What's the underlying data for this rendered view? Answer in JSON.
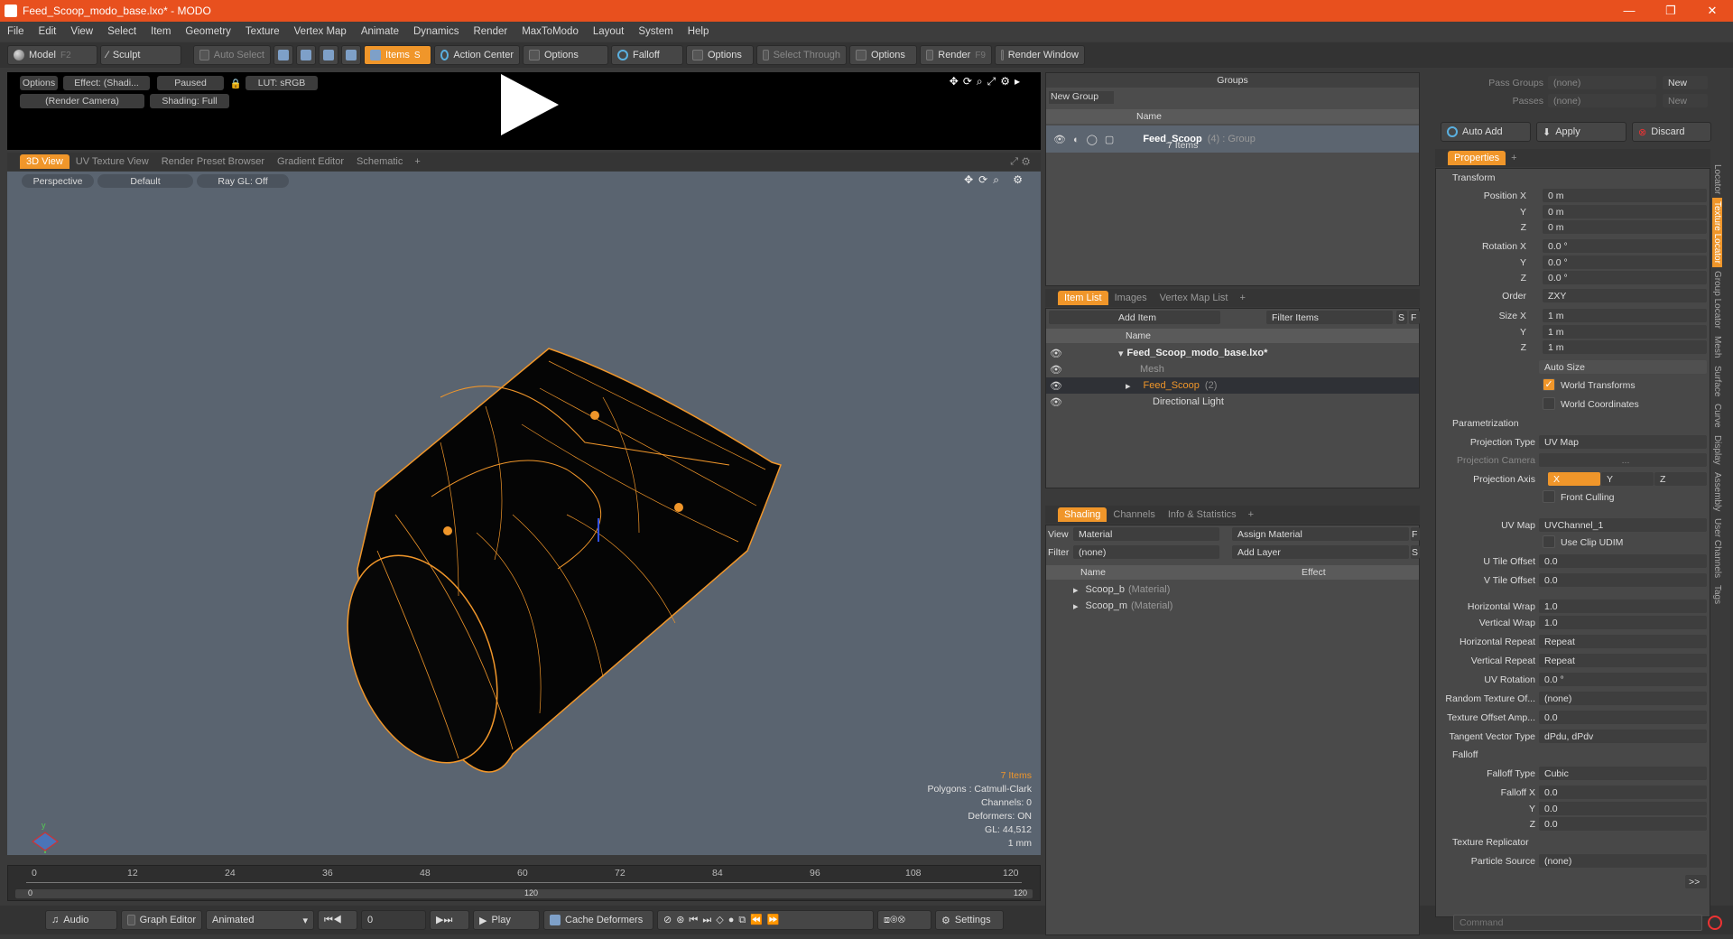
{
  "window": {
    "title": "Feed_Scoop_modo_base.lxo* - MODO",
    "minimize": "—",
    "maximize": "❐",
    "close": "✕"
  },
  "menu": [
    "File",
    "Edit",
    "View",
    "Select",
    "Item",
    "Geometry",
    "Texture",
    "Vertex Map",
    "Animate",
    "Dynamics",
    "Render",
    "MaxToModo",
    "Layout",
    "System",
    "Help"
  ],
  "toolbar": {
    "model": "Model",
    "model_key": "F2",
    "sculpt": "Sculpt",
    "auto_select": "Auto Select",
    "items": "Items",
    "items_key": "S",
    "action_center": "Action Center",
    "options1": "Options",
    "falloff": "Falloff",
    "options2": "Options",
    "select_through": "Select Through",
    "options3": "Options",
    "render": "Render",
    "render_key": "F9",
    "render_window": "Render Window"
  },
  "preview": {
    "options": "Options",
    "effect": "Effect: (Shadi...",
    "paused": "Paused",
    "lut": "LUT: sRGB",
    "camera": "(Render Camera)",
    "shading": "Shading: Full"
  },
  "view_tabs": [
    "3D View",
    "UV Texture View",
    "Render Preset Browser",
    "Gradient Editor",
    "Schematic",
    "+"
  ],
  "viewport": {
    "perspective": "Perspective",
    "default": "Default",
    "raygl": "Ray GL: Off",
    "stats": {
      "items": "7 Items",
      "polygons": "Polygons : Catmull-Clark",
      "channels": "Channels: 0",
      "deformers": "Deformers: ON",
      "gl": "GL: 44,512",
      "unit": "1 mm"
    }
  },
  "timeline": {
    "ticks": [
      "0",
      "12",
      "24",
      "36",
      "48",
      "60",
      "72",
      "84",
      "96",
      "108",
      "120"
    ],
    "low": "0",
    "mid": "120",
    "high": "120"
  },
  "bottom": {
    "audio": "Audio",
    "graph_editor": "Graph Editor",
    "animated": "Animated",
    "frame": "0",
    "play": "Play",
    "cache": "Cache Deformers",
    "settings": "Settings"
  },
  "groups": {
    "title": "Groups",
    "new_group": "New Group",
    "col_name": "Name",
    "item_name": "Feed_Scoop",
    "item_meta": "(4) : Group",
    "item_sub": "7 Items"
  },
  "itemlist": {
    "tabs": [
      "Item List",
      "Images",
      "Vertex Map List",
      "+"
    ],
    "add_item": "Add Item",
    "filter": "Filter Items",
    "s": "S",
    "f": "F",
    "col_name": "Name",
    "rows": [
      {
        "name": "Feed_Scoop_modo_base.lxo*",
        "meta": ""
      },
      {
        "name": "Mesh",
        "meta": ""
      },
      {
        "name": "Feed_Scoop",
        "meta": "(2)"
      },
      {
        "name": "Directional Light",
        "meta": ""
      }
    ]
  },
  "shading": {
    "tabs": [
      "Shading",
      "Channels",
      "Info & Statistics",
      "+"
    ],
    "view_label": "View",
    "view_value": "Material",
    "assign": "Assign Material",
    "f": "F",
    "filter_label": "Filter",
    "filter_value": "(none)",
    "add_layer": "Add Layer",
    "s": "S",
    "col_name": "Name",
    "col_effect": "Effect",
    "rows": [
      {
        "name": "Scoop_b",
        "meta": "(Material)"
      },
      {
        "name": "Scoop_m",
        "meta": "(Material)"
      }
    ]
  },
  "passes": {
    "pass_groups": "Pass Groups",
    "passes": "Passes",
    "none": "(none)",
    "new": "New",
    "auto_add": "Auto Add",
    "apply": "Apply",
    "discard": "Discard"
  },
  "properties": {
    "tab": "Properties",
    "plus": "+",
    "transform": "Transform",
    "pos_x": "Position X",
    "pos_x_v": "0 m",
    "pos_y": "Y",
    "pos_y_v": "0 m",
    "pos_z": "Z",
    "pos_z_v": "0 m",
    "rot_x": "Rotation X",
    "rot_x_v": "0.0 °",
    "rot_y": "Y",
    "rot_y_v": "0.0 °",
    "rot_z": "Z",
    "rot_z_v": "0.0 °",
    "order": "Order",
    "order_v": "ZXY",
    "size_x": "Size X",
    "size_x_v": "1 m",
    "size_y": "Y",
    "size_y_v": "1 m",
    "size_z": "Z",
    "size_z_v": "1 m",
    "auto_size": "Auto Size",
    "world_transforms": "World Transforms",
    "world_coords": "World Coordinates",
    "parametrization": "Parametrization",
    "proj_type": "Projection Type",
    "proj_type_v": "UV Map",
    "proj_cam": "Projection Camera",
    "proj_cam_v": "...",
    "proj_axis": "Projection Axis",
    "ax_x": "X",
    "ax_y": "Y",
    "ax_z": "Z",
    "front_culling": "Front Culling",
    "uv_map": "UV Map",
    "uv_map_v": "UVChannel_1",
    "use_clip": "Use Clip UDIM",
    "u_tile": "U Tile Offset",
    "u_tile_v": "0.0",
    "v_tile": "V Tile Offset",
    "v_tile_v": "0.0",
    "h_wrap": "Horizontal Wrap",
    "h_wrap_v": "1.0",
    "v_wrap": "Vertical Wrap",
    "v_wrap_v": "1.0",
    "h_rep": "Horizontal Repeat",
    "h_rep_v": "Repeat",
    "v_rep": "Vertical Repeat",
    "v_rep_v": "Repeat",
    "uv_rot": "UV Rotation",
    "uv_rot_v": "0.0 °",
    "rand_tex": "Random Texture Of...",
    "rand_tex_v": "(none)",
    "tex_amp": "Texture Offset Amp...",
    "tex_amp_v": "0.0",
    "tangent": "Tangent Vector Type",
    "tangent_v": "dPdu, dPdv",
    "falloff": "Falloff",
    "falloff_type": "Falloff Type",
    "falloff_type_v": "Cubic",
    "fo_x": "Falloff X",
    "fo_x_v": "0.0",
    "fo_y": "Y",
    "fo_y_v": "0.0",
    "fo_z": "Z",
    "fo_z_v": "0.0",
    "replicator": "Texture Replicator",
    "particle": "Particle Source",
    "particle_v": "(none)",
    "more": ">>"
  },
  "vtabs": [
    "Locator",
    "Texture Locator",
    "Group Locator",
    "Mesh",
    "Surface",
    "Curve",
    "Display",
    "Assembly",
    "User Channels",
    "Tags"
  ],
  "command": {
    "placeholder": "Command"
  }
}
